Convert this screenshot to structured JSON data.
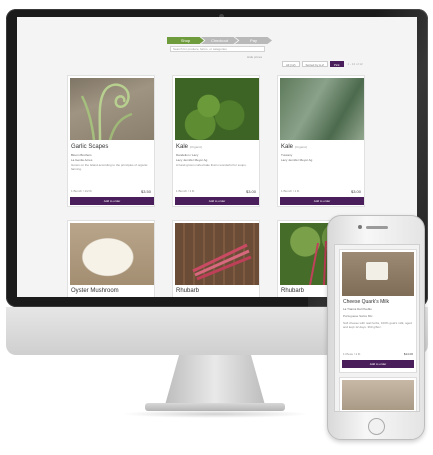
{
  "steps": [
    {
      "label": "Shop"
    },
    {
      "label": "Checkout"
    },
    {
      "label": "Pay"
    }
  ],
  "search": {
    "placeholder": "Search for produce, farms, or categories"
  },
  "price_link": "Hide prices",
  "filters": {
    "chips": [
      "All (12)",
      "Sorted by A-Z",
      "",
      "Pick"
    ],
    "pager": "1 - 12 of 12"
  },
  "products": [
    {
      "title": "Garlic Scapes",
      "small": "",
      "farm": "Bloom Brothers",
      "org": "La Gentle Acres",
      "desc": "Grown on the Island according to the principles of organic farming.",
      "unit": "1 Bunch / 1/2 lb",
      "price": "$3.50"
    },
    {
      "title": "Kale",
      "small": "(Organic)",
      "farm": "Dandelion / Lacy",
      "org": "Lacy Jennifer Meyer Ag",
      "desc": "A hand-grown curled kale that is wonderful for soups.",
      "unit": "1 Bunch / 1 lb",
      "price": "$3.00"
    },
    {
      "title": "Kale",
      "small": "(Organic)",
      "farm": "Tuscany",
      "org": "Lacy Jennifer Meyer Ag",
      "desc": "",
      "unit": "1 Bunch / 1 lb",
      "price": "$3.00"
    },
    {
      "title": "Oyster Mushroom"
    },
    {
      "title": "Rhubarb"
    },
    {
      "title": "Rhubarb"
    }
  ],
  "order_label": "Add to order",
  "phone": {
    "title": "Cheese Quark's Milk",
    "farm": "La Tranca Del Pueblo",
    "org": "Portuguese Swiss Mix",
    "desc": "Soft cheese with real herbs, 100% goat's milk, aged and kept 12 days. 360 g/6oz.",
    "unit": "1 Piece / 1 lb",
    "price": "$14.00",
    "order_label": "Add to order"
  }
}
